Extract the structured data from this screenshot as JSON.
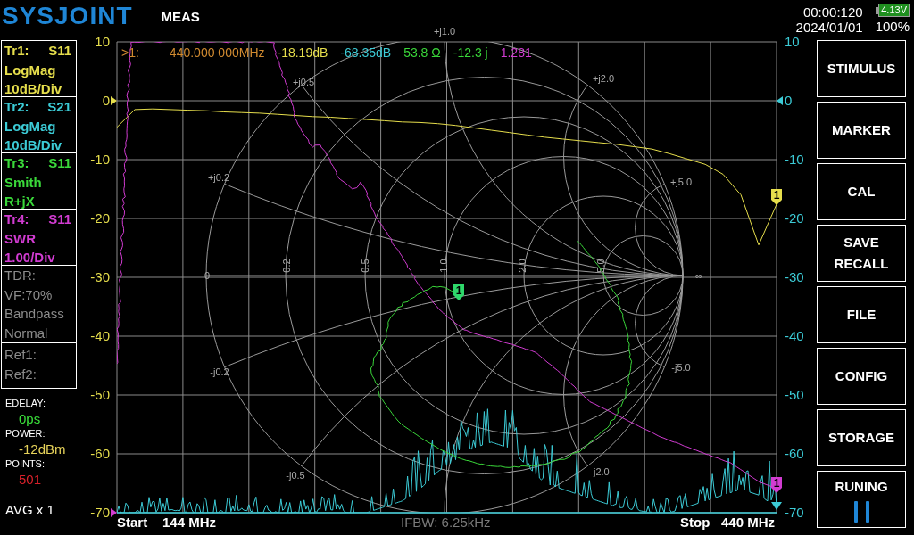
{
  "header": {
    "logo": "SYSJOINT",
    "mode": "MEAS",
    "time": "00:00:120",
    "date": "2024/01/01",
    "battery_voltage": "4.13V",
    "battery_percent": "100%"
  },
  "traces": [
    {
      "name": "Tr1:",
      "param": "S11",
      "format": "LogMag",
      "scale": "10dB/Div",
      "color": "#e6de4c"
    },
    {
      "name": "Tr2:",
      "param": "S21",
      "format": "LogMag",
      "scale": "10dB/Div",
      "color": "#3ccbd6"
    },
    {
      "name": "Tr3:",
      "param": "S11",
      "format": "Smith",
      "scale": "R+jX",
      "color": "#3ad83a"
    },
    {
      "name": "Tr4:",
      "param": "S11",
      "format": "SWR",
      "scale": "1.00/Div",
      "color": "#d23cd2"
    }
  ],
  "tdr": [
    "TDR:",
    "VF:70%",
    "Bandpass",
    "Normal"
  ],
  "refs": [
    "Ref1:",
    "Ref2:"
  ],
  "settings": [
    {
      "label": "EDELAY:",
      "value": "0ps",
      "color": "#3ae03a"
    },
    {
      "label": "POWER:",
      "value": "-12dBm",
      "color": "#e6d25a"
    },
    {
      "label": "POINTS:",
      "value": "501",
      "color": "#d8202a"
    }
  ],
  "averaging": "AVG x 1",
  "readout": [
    {
      "text": ">1:",
      "color": "#d08a30"
    },
    {
      "text": "440.000 000MHz",
      "color": "#d08a30"
    },
    {
      "text": "-18.19dB",
      "color": "#e6de4c"
    },
    {
      "text": "-68.35dB",
      "color": "#3ccbd6"
    },
    {
      "text": "53.8 Ω",
      "color": "#3ad83a"
    },
    {
      "text": "-12.3 j",
      "color": "#3ad83a"
    },
    {
      "text": "1.281",
      "color": "#d23cd2"
    }
  ],
  "left_axis": [
    {
      "label": "10",
      "ref": false
    },
    {
      "label": "0",
      "ref": true
    },
    {
      "label": "-10",
      "ref": false
    },
    {
      "label": "-20",
      "ref": false
    },
    {
      "label": "-30",
      "ref": false
    },
    {
      "label": "-40",
      "ref": false
    },
    {
      "label": "-50",
      "ref": false
    },
    {
      "label": "-60",
      "ref": false
    },
    {
      "label": "-70",
      "ref": true
    }
  ],
  "right_axis": [
    {
      "label": "10",
      "ref": false
    },
    {
      "label": "0",
      "ref": true
    },
    {
      "label": "-10",
      "ref": false
    },
    {
      "label": "-20",
      "ref": false
    },
    {
      "label": "-30",
      "ref": false
    },
    {
      "label": "-40",
      "ref": false
    },
    {
      "label": "-50",
      "ref": false
    },
    {
      "label": "-60",
      "ref": false
    },
    {
      "label": "-70",
      "ref": false
    }
  ],
  "smith_labels": [
    "+j1.0",
    "+j0.5",
    "+j2.0",
    "+j0.2",
    "+j5.0",
    "0",
    "0.2",
    "0.5",
    "1.0",
    "2.0",
    "5.0",
    "∞",
    "-j0.2",
    "-j5.0",
    "-j0.5",
    "-j2.0"
  ],
  "markers": [
    {
      "label": "1",
      "color": "#e6de4c"
    },
    {
      "label": "1",
      "color": "#2ed86a"
    },
    {
      "label": "1",
      "color": "#d23cd2"
    }
  ],
  "footer": {
    "start_label": "Start",
    "start": "144 MHz",
    "ifbw": "IFBW: 6.25kHz",
    "stop_label": "Stop",
    "stop": "440 MHz"
  },
  "buttons": [
    {
      "label": "STIMULUS",
      "kind": "menu"
    },
    {
      "label": "MARKER",
      "kind": "menu"
    },
    {
      "label": "CAL",
      "kind": "menu"
    },
    {
      "label": "SAVE\nRECALL",
      "kind": "menu"
    },
    {
      "label": "FILE",
      "kind": "menu"
    },
    {
      "label": "CONFIG",
      "kind": "menu"
    },
    {
      "label": "STORAGE",
      "kind": "menu"
    },
    {
      "label": "RUNING",
      "kind": "pause"
    }
  ]
}
